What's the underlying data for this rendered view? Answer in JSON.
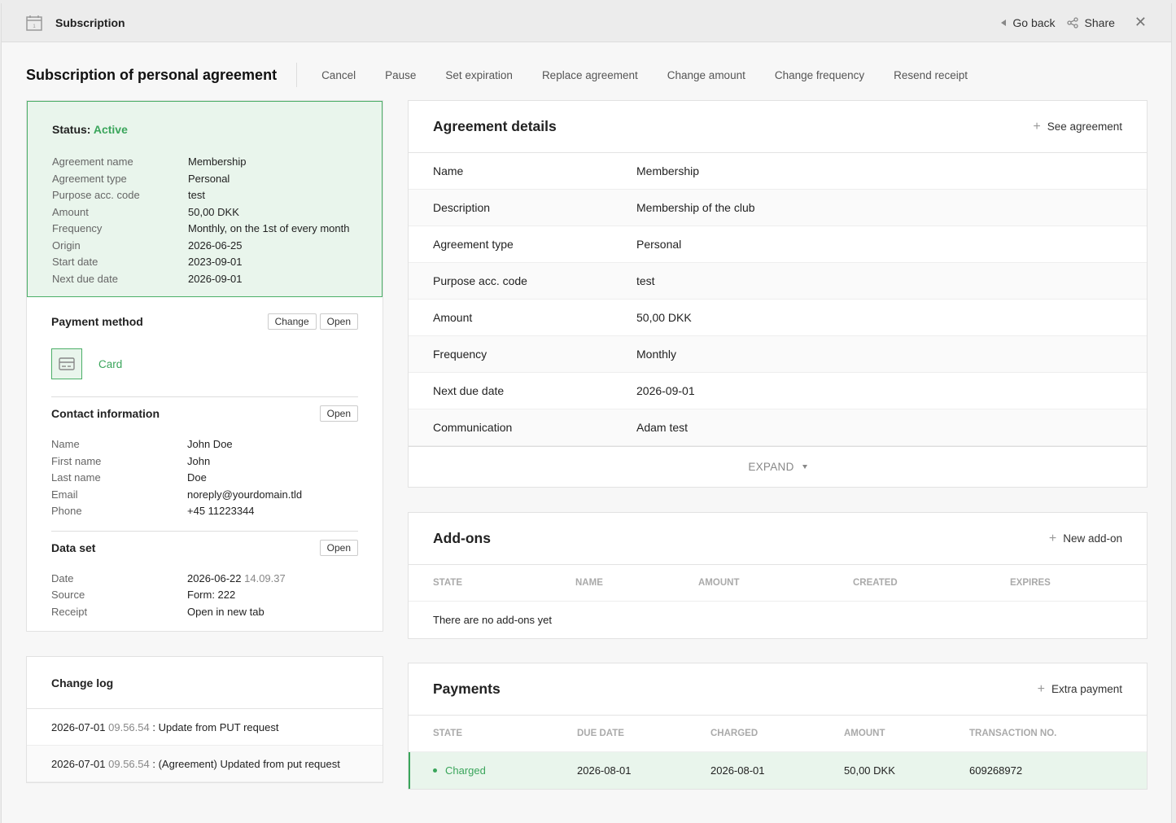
{
  "topbar": {
    "title": "Subscription",
    "go_back": "Go back",
    "share": "Share"
  },
  "page": {
    "title": "Subscription of personal agreement",
    "actions": [
      "Cancel",
      "Pause",
      "Set expiration",
      "Replace agreement",
      "Change amount",
      "Change frequency",
      "Resend receipt"
    ]
  },
  "status": {
    "label": "Status:",
    "value": "Active",
    "color": "#3aa55b",
    "rows": [
      {
        "k": "Agreement name",
        "v": "Membership"
      },
      {
        "k": "Agreement type",
        "v": "Personal"
      },
      {
        "k": "Purpose acc. code",
        "v": "test"
      },
      {
        "k": "Amount",
        "v": "50,00 DKK"
      },
      {
        "k": "Frequency",
        "v": "Monthly, on the 1st of every month"
      },
      {
        "k": "Origin",
        "v": "2026-06-25"
      },
      {
        "k": "Start date",
        "v": "2023-09-01"
      },
      {
        "k": "Next due date",
        "v": "2026-09-01"
      }
    ]
  },
  "payment_method": {
    "title": "Payment method",
    "change": "Change",
    "open": "Open",
    "type": "Card"
  },
  "contact": {
    "title": "Contact information",
    "open": "Open",
    "rows": [
      {
        "k": "Name",
        "v": "John Doe"
      },
      {
        "k": "First name",
        "v": "John"
      },
      {
        "k": "Last name",
        "v": "Doe"
      },
      {
        "k": "Email",
        "v": "noreply@yourdomain.tld",
        "link": true
      },
      {
        "k": "Phone",
        "v": "+45 11223344"
      }
    ]
  },
  "dataset": {
    "title": "Data set",
    "open": "Open",
    "date_label": "Date",
    "date": "2026-06-22",
    "time": "14.09.37",
    "source_label": "Source",
    "source": "Form: 222",
    "receipt_label": "Receipt",
    "receipt": "Open in new tab"
  },
  "changelog": {
    "title": "Change log",
    "entries": [
      {
        "date": "2026-07-01",
        "time": "09.56.54",
        "text": ": Update from PUT request"
      },
      {
        "date": "2026-07-01",
        "time": "09.56.54",
        "text": ": (Agreement) Updated from put request"
      }
    ]
  },
  "agreement": {
    "title": "Agreement details",
    "see": "See agreement",
    "rows": [
      {
        "k": "Name",
        "v": "Membership"
      },
      {
        "k": "Description",
        "v": "Membership of the club"
      },
      {
        "k": "Agreement type",
        "v": "Personal"
      },
      {
        "k": "Purpose acc. code",
        "v": "test"
      },
      {
        "k": "Amount",
        "v": "50,00 DKK"
      },
      {
        "k": "Frequency",
        "v": "Monthly"
      },
      {
        "k": "Next due date",
        "v": "2026-09-01"
      },
      {
        "k": "Communication",
        "v": "Adam test",
        "link": true
      }
    ],
    "expand": "EXPAND"
  },
  "addons": {
    "title": "Add-ons",
    "new": "New add-on",
    "columns": [
      "STATE",
      "NAME",
      "AMOUNT",
      "CREATED",
      "EXPIRES"
    ],
    "empty": "There are no add-ons yet"
  },
  "payments": {
    "title": "Payments",
    "extra": "Extra payment",
    "columns": [
      "STATE",
      "DUE DATE",
      "CHARGED",
      "AMOUNT",
      "TRANSACTION NO."
    ],
    "rows": [
      {
        "state": "Charged",
        "due": "2026-08-01",
        "charged": "2026-08-01",
        "amount": "50,00 DKK",
        "txn": "609268972"
      }
    ]
  }
}
